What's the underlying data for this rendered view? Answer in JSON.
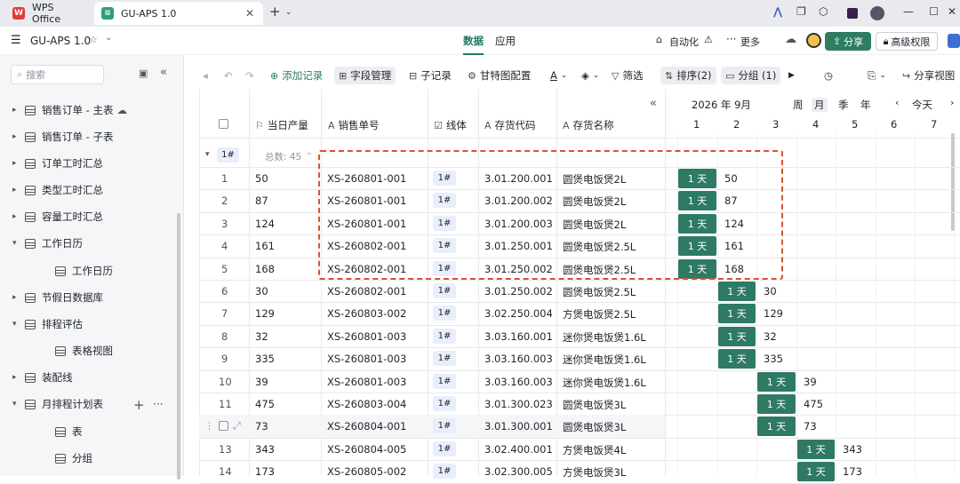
{
  "browser": {
    "tabs": [
      {
        "label": "WPS Office"
      },
      {
        "label": "GU-APS 1.0"
      }
    ]
  },
  "app": {
    "title": "GU-APS 1.0",
    "center_tabs": [
      "数据",
      "应用"
    ],
    "automation": "自动化",
    "more": "更多",
    "share": "分享",
    "permissions": "高级权限"
  },
  "sidebar": {
    "search_placeholder": "搜索",
    "items": [
      {
        "label": "销售订单 - 主表"
      },
      {
        "label": "销售订单 - 子表"
      },
      {
        "label": "订单工时汇总"
      },
      {
        "label": "类型工时汇总"
      },
      {
        "label": "容量工时汇总"
      },
      {
        "label": "工作日历"
      },
      {
        "label": "工作日历"
      },
      {
        "label": "节假日数据库"
      },
      {
        "label": "排程评估"
      },
      {
        "label": "表格视图"
      },
      {
        "label": "装配线"
      },
      {
        "label": "月排程计划表"
      },
      {
        "label": "表"
      },
      {
        "label": "分组"
      }
    ]
  },
  "toolbar": {
    "add_record": "添加记录",
    "field_manage": "字段管理",
    "sub_record": "子记录",
    "gantt_config": "甘特图配置",
    "filter": "筛选",
    "sort": "排序(2)",
    "group": "分组 (1)",
    "share_view": "分享视图"
  },
  "table": {
    "columns": [
      "当日产量",
      "销售单号",
      "线体",
      "存货代码",
      "存货名称"
    ],
    "group_tag": "1#",
    "group_total": "总数: 45",
    "rows": [
      {
        "n": "1",
        "qty": "50",
        "order": "XS-260801-001",
        "line": "1#",
        "code": "3.01.200.001",
        "name": "圆煲电饭煲2L",
        "bar": "1 天"
      },
      {
        "n": "2",
        "qty": "87",
        "order": "XS-260801-001",
        "line": "1#",
        "code": "3.01.200.002",
        "name": "圆煲电饭煲2L",
        "bar": "1 天"
      },
      {
        "n": "3",
        "qty": "124",
        "order": "XS-260801-001",
        "line": "1#",
        "code": "3.01.200.003",
        "name": "圆煲电饭煲2L",
        "bar": "1 天"
      },
      {
        "n": "4",
        "qty": "161",
        "order": "XS-260802-001",
        "line": "1#",
        "code": "3.01.250.001",
        "name": "圆煲电饭煲2.5L",
        "bar": "1 天"
      },
      {
        "n": "5",
        "qty": "168",
        "order": "XS-260802-001",
        "line": "1#",
        "code": "3.01.250.002",
        "name": "圆煲电饭煲2.5L",
        "bar": "1 天"
      },
      {
        "n": "6",
        "qty": "30",
        "order": "XS-260802-001",
        "line": "1#",
        "code": "3.01.250.002",
        "name": "圆煲电饭煲2.5L",
        "bar": "1 天"
      },
      {
        "n": "7",
        "qty": "129",
        "order": "XS-260803-002",
        "line": "1#",
        "code": "3.02.250.004",
        "name": "方煲电饭煲2.5L",
        "bar": "1 天"
      },
      {
        "n": "8",
        "qty": "32",
        "order": "XS-260801-003",
        "line": "1#",
        "code": "3.03.160.001",
        "name": "迷你煲电饭煲1.6L",
        "bar": "1 天"
      },
      {
        "n": "9",
        "qty": "335",
        "order": "XS-260801-003",
        "line": "1#",
        "code": "3.03.160.003",
        "name": "迷你煲电饭煲1.6L",
        "bar": "1 天"
      },
      {
        "n": "10",
        "qty": "39",
        "order": "XS-260801-003",
        "line": "1#",
        "code": "3.03.160.003",
        "name": "迷你煲电饭煲1.6L",
        "bar": "1 天"
      },
      {
        "n": "11",
        "qty": "475",
        "order": "XS-260803-004",
        "line": "1#",
        "code": "3.01.300.023",
        "name": "圆煲电饭煲3L",
        "bar": "1 天"
      },
      {
        "n": "",
        "qty": "73",
        "order": "XS-260804-001",
        "line": "1#",
        "code": "3.01.300.001",
        "name": "圆煲电饭煲3L",
        "bar": "1 天"
      },
      {
        "n": "13",
        "qty": "343",
        "order": "XS-260804-005",
        "line": "1#",
        "code": "3.02.400.001",
        "name": "方煲电饭煲4L",
        "bar": "1 天"
      },
      {
        "n": "14",
        "qty": "173",
        "order": "XS-260805-002",
        "line": "1#",
        "code": "3.02.300.005",
        "name": "方煲电饭煲3L",
        "bar": "1 天"
      }
    ]
  },
  "gantt": {
    "month": "2026 年 9月",
    "scale": [
      "周",
      "月",
      "季",
      "年"
    ],
    "today": "今天",
    "days": [
      "1",
      "2",
      "3",
      "4",
      "5",
      "6",
      "7"
    ],
    "row_days": [
      1,
      1,
      1,
      1,
      1,
      2,
      2,
      2,
      2,
      3,
      3,
      3,
      4,
      4
    ]
  }
}
